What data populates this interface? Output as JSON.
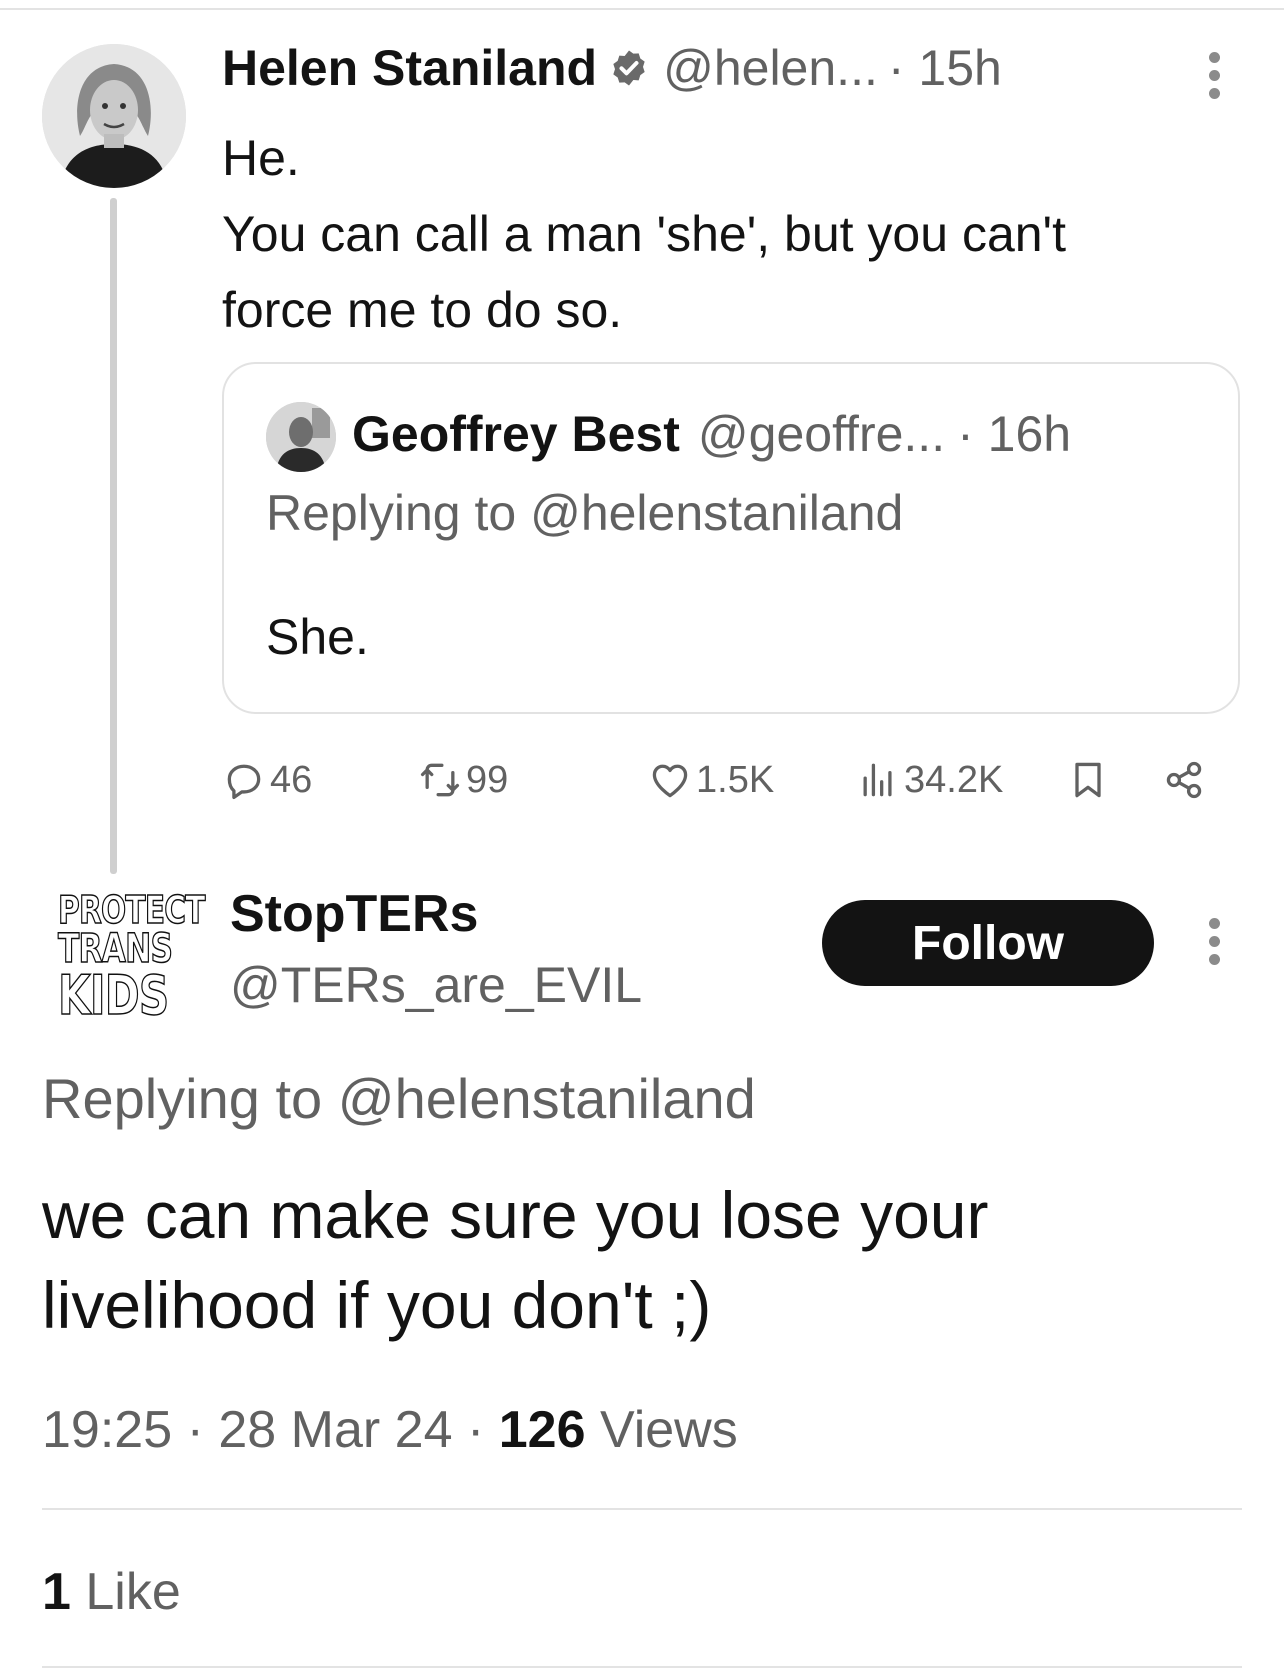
{
  "parent_tweet": {
    "author_name": "Helen Staniland",
    "handle": "@helen...",
    "time": "· 15h",
    "text_lines": [
      "He.",
      "You can call a man 'she', but you can't",
      "force me to do so."
    ],
    "quoted": {
      "author_name": "Geoffrey Best",
      "handle": "@geoffre...",
      "time": "· 16h",
      "replying_prefix": "Replying to",
      "replying_handle": "@helenstaniland",
      "text": "She."
    },
    "stats": {
      "replies": "46",
      "retweets": "99",
      "likes": "1.5K",
      "views": "34.2K"
    }
  },
  "main_tweet": {
    "author_name": "StopTERs",
    "handle": "@TERs_are_EVIL",
    "avatar_text": [
      "PROTECT",
      "TRANS",
      "KIDS"
    ],
    "follow_label": "Follow",
    "replying_prefix": "Replying to",
    "replying_handle": "@helenstaniland",
    "text_lines": [
      "we can make sure you lose your",
      "livelihood if you don't ;)"
    ],
    "time": "19:25",
    "date": "28 Mar 24",
    "views_count": "126",
    "views_label": "Views",
    "likes_count": "1",
    "likes_label": "Like"
  },
  "icons": {
    "verified": "verified-badge-icon",
    "more": "more-options-icon",
    "reply": "reply-bubble-icon",
    "retweet": "retweet-icon",
    "like": "heart-icon",
    "views": "views-bar-chart-icon",
    "bookmark": "bookmark-icon",
    "share": "share-icon"
  },
  "colors": {
    "text_primary": "#0f1419",
    "text_secondary": "#536471",
    "border": "#dfe3e6",
    "follow_bg": "#0f1419"
  }
}
